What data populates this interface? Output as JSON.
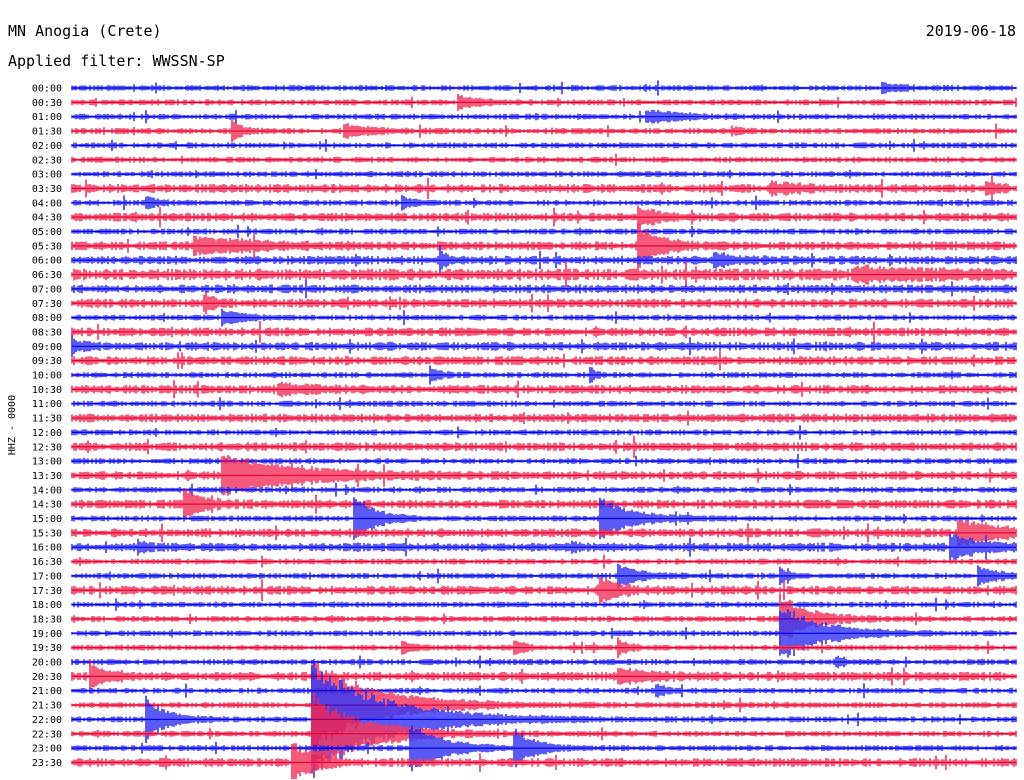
{
  "header": {
    "station": "MN Anogia (Crete)",
    "date": "2019-06-18",
    "filter": "Applied filter: WWSSN-SP"
  },
  "chart_data": {
    "type": "line",
    "title": "MN Anogia (Crete)",
    "subtitle": "Applied filter: WWSSN-SP",
    "date": "2019-06-18",
    "ylabel": "HHZ - 0000",
    "xlabel": "",
    "grid": false,
    "legend": "none",
    "series_colors": [
      "#0000ee",
      "#ee0033"
    ],
    "categories": [
      "00:00",
      "00:30",
      "01:00",
      "01:30",
      "02:00",
      "02:30",
      "03:00",
      "03:30",
      "04:00",
      "04:30",
      "05:00",
      "05:30",
      "06:00",
      "06:30",
      "07:00",
      "07:30",
      "08:00",
      "08:30",
      "09:00",
      "09:30",
      "10:00",
      "10:30",
      "11:00",
      "11:30",
      "12:00",
      "12:30",
      "13:00",
      "13:30",
      "14:00",
      "14:30",
      "15:00",
      "15:30",
      "16:00",
      "16:30",
      "17:00",
      "17:30",
      "18:00",
      "18:30",
      "19:00",
      "19:30",
      "20:00",
      "20:30",
      "21:00",
      "21:30",
      "22:00",
      "22:30",
      "23:00",
      "23:30"
    ],
    "noise": [
      2,
      2,
      2,
      2,
      2,
      2,
      2,
      3,
      2,
      3,
      2,
      3,
      3,
      4,
      3,
      3,
      2,
      3,
      3,
      3,
      2,
      3,
      2,
      3,
      2,
      3,
      2,
      3,
      2,
      3,
      2,
      3,
      3,
      2,
      2,
      3,
      2,
      2,
      2,
      2,
      2,
      3,
      2,
      2,
      2,
      2,
      2,
      3
    ],
    "events": [
      {
        "row": 0,
        "x": 0.86,
        "amp": 4,
        "dur": 0.02
      },
      {
        "row": 1,
        "x": 0.41,
        "amp": 6,
        "dur": 0.02
      },
      {
        "row": 2,
        "x": 0.61,
        "amp": 7,
        "dur": 0.03
      },
      {
        "row": 3,
        "x": 0.17,
        "amp": 10,
        "dur": 0.01
      },
      {
        "row": 3,
        "x": 0.29,
        "amp": 6,
        "dur": 0.03
      },
      {
        "row": 3,
        "x": 0.7,
        "amp": 4,
        "dur": 0.01
      },
      {
        "row": 7,
        "x": 0.74,
        "amp": 5,
        "dur": 0.03
      },
      {
        "row": 7,
        "x": 0.97,
        "amp": 6,
        "dur": 0.01
      },
      {
        "row": 8,
        "x": 0.08,
        "amp": 6,
        "dur": 0.01
      },
      {
        "row": 8,
        "x": 0.35,
        "amp": 6,
        "dur": 0.01
      },
      {
        "row": 9,
        "x": 0.6,
        "amp": 9,
        "dur": 0.02
      },
      {
        "row": 11,
        "x": 0.6,
        "amp": 22,
        "dur": 0.02
      },
      {
        "row": 11,
        "x": 0.13,
        "amp": 8,
        "dur": 0.06
      },
      {
        "row": 12,
        "x": 0.68,
        "amp": 7,
        "dur": 0.02
      },
      {
        "row": 12,
        "x": 0.39,
        "amp": 12,
        "dur": 0.005
      },
      {
        "row": 13,
        "x": 0.83,
        "amp": 6,
        "dur": 0.07
      },
      {
        "row": 15,
        "x": 0.14,
        "amp": 8,
        "dur": 0.01
      },
      {
        "row": 16,
        "x": 0.16,
        "amp": 8,
        "dur": 0.02
      },
      {
        "row": 18,
        "x": 0.0,
        "amp": 8,
        "dur": 0.01
      },
      {
        "row": 20,
        "x": 0.38,
        "amp": 7,
        "dur": 0.01
      },
      {
        "row": 20,
        "x": 0.55,
        "amp": 8,
        "dur": 0.005
      },
      {
        "row": 21,
        "x": 0.22,
        "amp": 5,
        "dur": 0.03
      },
      {
        "row": 27,
        "x": 0.16,
        "amp": 20,
        "dur": 0.07
      },
      {
        "row": 29,
        "x": 0.12,
        "amp": 13,
        "dur": 0.02
      },
      {
        "row": 30,
        "x": 0.3,
        "amp": 25,
        "dur": 0.02
      },
      {
        "row": 30,
        "x": 0.56,
        "amp": 22,
        "dur": 0.03
      },
      {
        "row": 31,
        "x": 0.94,
        "amp": 11,
        "dur": 0.05
      },
      {
        "row": 32,
        "x": 0.93,
        "amp": 12,
        "dur": 0.03
      },
      {
        "row": 32,
        "x": 0.07,
        "amp": 5,
        "dur": 0.01
      },
      {
        "row": 32,
        "x": 0.53,
        "amp": 5,
        "dur": 0.01
      },
      {
        "row": 34,
        "x": 0.58,
        "amp": 12,
        "dur": 0.02
      },
      {
        "row": 34,
        "x": 0.75,
        "amp": 7,
        "dur": 0.01
      },
      {
        "row": 34,
        "x": 0.96,
        "amp": 9,
        "dur": 0.02
      },
      {
        "row": 35,
        "x": 0.56,
        "amp": 11,
        "dur": 0.02
      },
      {
        "row": 37,
        "x": 0.75,
        "amp": 24,
        "dur": 0.03
      },
      {
        "row": 38,
        "x": 0.75,
        "amp": 30,
        "dur": 0.04
      },
      {
        "row": 39,
        "x": 0.35,
        "amp": 6,
        "dur": 0.01
      },
      {
        "row": 39,
        "x": 0.47,
        "amp": 7,
        "dur": 0.01
      },
      {
        "row": 39,
        "x": 0.58,
        "amp": 8,
        "dur": 0.01
      },
      {
        "row": 40,
        "x": 0.81,
        "amp": 5,
        "dur": 0.01
      },
      {
        "row": 41,
        "x": 0.02,
        "amp": 10,
        "dur": 0.02
      },
      {
        "row": 41,
        "x": 0.58,
        "amp": 7,
        "dur": 0.03
      },
      {
        "row": 42,
        "x": 0.62,
        "amp": 6,
        "dur": 0.01
      },
      {
        "row": 44,
        "x": 0.08,
        "amp": 22,
        "dur": 0.02
      },
      {
        "row": 43,
        "x": 0.255,
        "amp": 48,
        "dur": 0.06
      },
      {
        "row": 44,
        "x": 0.255,
        "amp": 60,
        "dur": 0.07
      },
      {
        "row": 45,
        "x": 0.255,
        "amp": 40,
        "dur": 0.05
      },
      {
        "row": 46,
        "x": 0.36,
        "amp": 26,
        "dur": 0.03
      },
      {
        "row": 46,
        "x": 0.47,
        "amp": 17,
        "dur": 0.02
      },
      {
        "row": 47,
        "x": 0.235,
        "amp": 18,
        "dur": 0.02
      }
    ]
  }
}
